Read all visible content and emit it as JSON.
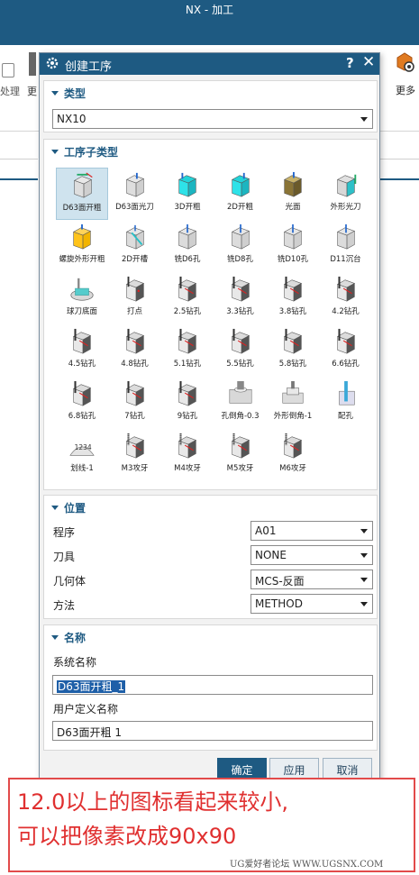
{
  "app": {
    "title": "NX - 加工"
  },
  "ribbon": {
    "left_fragment": "处理",
    "frag2": "更",
    "more_label": "更多"
  },
  "dialog": {
    "title": "创建工序",
    "help": "?",
    "close": "✕",
    "type_group": {
      "header": "类型",
      "selected": "NX10"
    },
    "subtype_group": {
      "header": "工序子类型",
      "tiles": [
        {
          "label": "D63面开粗",
          "icon": "face-rough-icon"
        },
        {
          "label": "D63面光刀",
          "icon": "face-finish-icon"
        },
        {
          "label": "3D开粗",
          "icon": "3d-rough-icon"
        },
        {
          "label": "2D开粗",
          "icon": "2d-rough-icon"
        },
        {
          "label": "光面",
          "icon": "face-smooth-icon"
        },
        {
          "label": "外形光刀",
          "icon": "profile-finish-icon"
        },
        {
          "label": "螺旋外形开粗",
          "icon": "helical-profile-icon"
        },
        {
          "label": "2D开槽",
          "icon": "2d-slot-icon"
        },
        {
          "label": "铣D6孔",
          "icon": "mill-d6-hole-icon"
        },
        {
          "label": "铣D8孔",
          "icon": "mill-d8-hole-icon"
        },
        {
          "label": "铣D10孔",
          "icon": "mill-d10-hole-icon"
        },
        {
          "label": "D11沉台",
          "icon": "counterbore-icon"
        },
        {
          "label": "球刀底面",
          "icon": "ball-floor-icon"
        },
        {
          "label": "打点",
          "icon": "spot-drill-icon"
        },
        {
          "label": "2.5钻孔",
          "icon": "drill-icon"
        },
        {
          "label": "3.3钻孔",
          "icon": "drill-icon"
        },
        {
          "label": "3.8钻孔",
          "icon": "drill-icon"
        },
        {
          "label": "4.2钻孔",
          "icon": "drill-icon"
        },
        {
          "label": "4.5钻孔",
          "icon": "drill-icon"
        },
        {
          "label": "4.8钻孔",
          "icon": "drill-icon"
        },
        {
          "label": "5.1钻孔",
          "icon": "drill-icon"
        },
        {
          "label": "5.5钻孔",
          "icon": "drill-icon"
        },
        {
          "label": "5.8钻孔",
          "icon": "drill-icon"
        },
        {
          "label": "6.6钻孔",
          "icon": "drill-icon"
        },
        {
          "label": "6.8钻孔",
          "icon": "drill-icon"
        },
        {
          "label": "7钻孔",
          "icon": "drill-icon"
        },
        {
          "label": "9钻孔",
          "icon": "drill-icon"
        },
        {
          "label": "孔倒角-0.3",
          "icon": "hole-chamfer-icon"
        },
        {
          "label": "外形倒角-1",
          "icon": "profile-chamfer-icon"
        },
        {
          "label": "配孔",
          "icon": "ream-hole-icon"
        },
        {
          "label": "划线-1",
          "icon": "engrave-icon"
        },
        {
          "label": "M3攻牙",
          "icon": "tap-icon"
        },
        {
          "label": "M4攻牙",
          "icon": "tap-icon"
        },
        {
          "label": "M5攻牙",
          "icon": "tap-icon"
        },
        {
          "label": "M6攻牙",
          "icon": "tap-icon"
        }
      ]
    },
    "location_group": {
      "header": "位置",
      "rows": [
        {
          "label": "程序",
          "value": "A01"
        },
        {
          "label": "刀具",
          "value": "NONE"
        },
        {
          "label": "几何体",
          "value": "MCS-反面"
        },
        {
          "label": "方法",
          "value": "METHOD"
        }
      ]
    },
    "name_group": {
      "header": "名称",
      "system_label": "系统名称",
      "system_value": "D63面开粗_1",
      "user_label": "用户定义名称",
      "user_value": "D63面开粗 1"
    },
    "buttons": {
      "ok": "确定",
      "apply": "应用",
      "cancel": "取消"
    }
  },
  "annotation": {
    "line1": "12.0以上的图标看起来较小,",
    "line2": "可以把像素改成90x90"
  },
  "watermark": "UG爱好者论坛 WWW.UGSNX.COM",
  "colors": {
    "titlebar": "#1e5a82",
    "accent": "#1e5a82",
    "annotation": "#e03030"
  }
}
